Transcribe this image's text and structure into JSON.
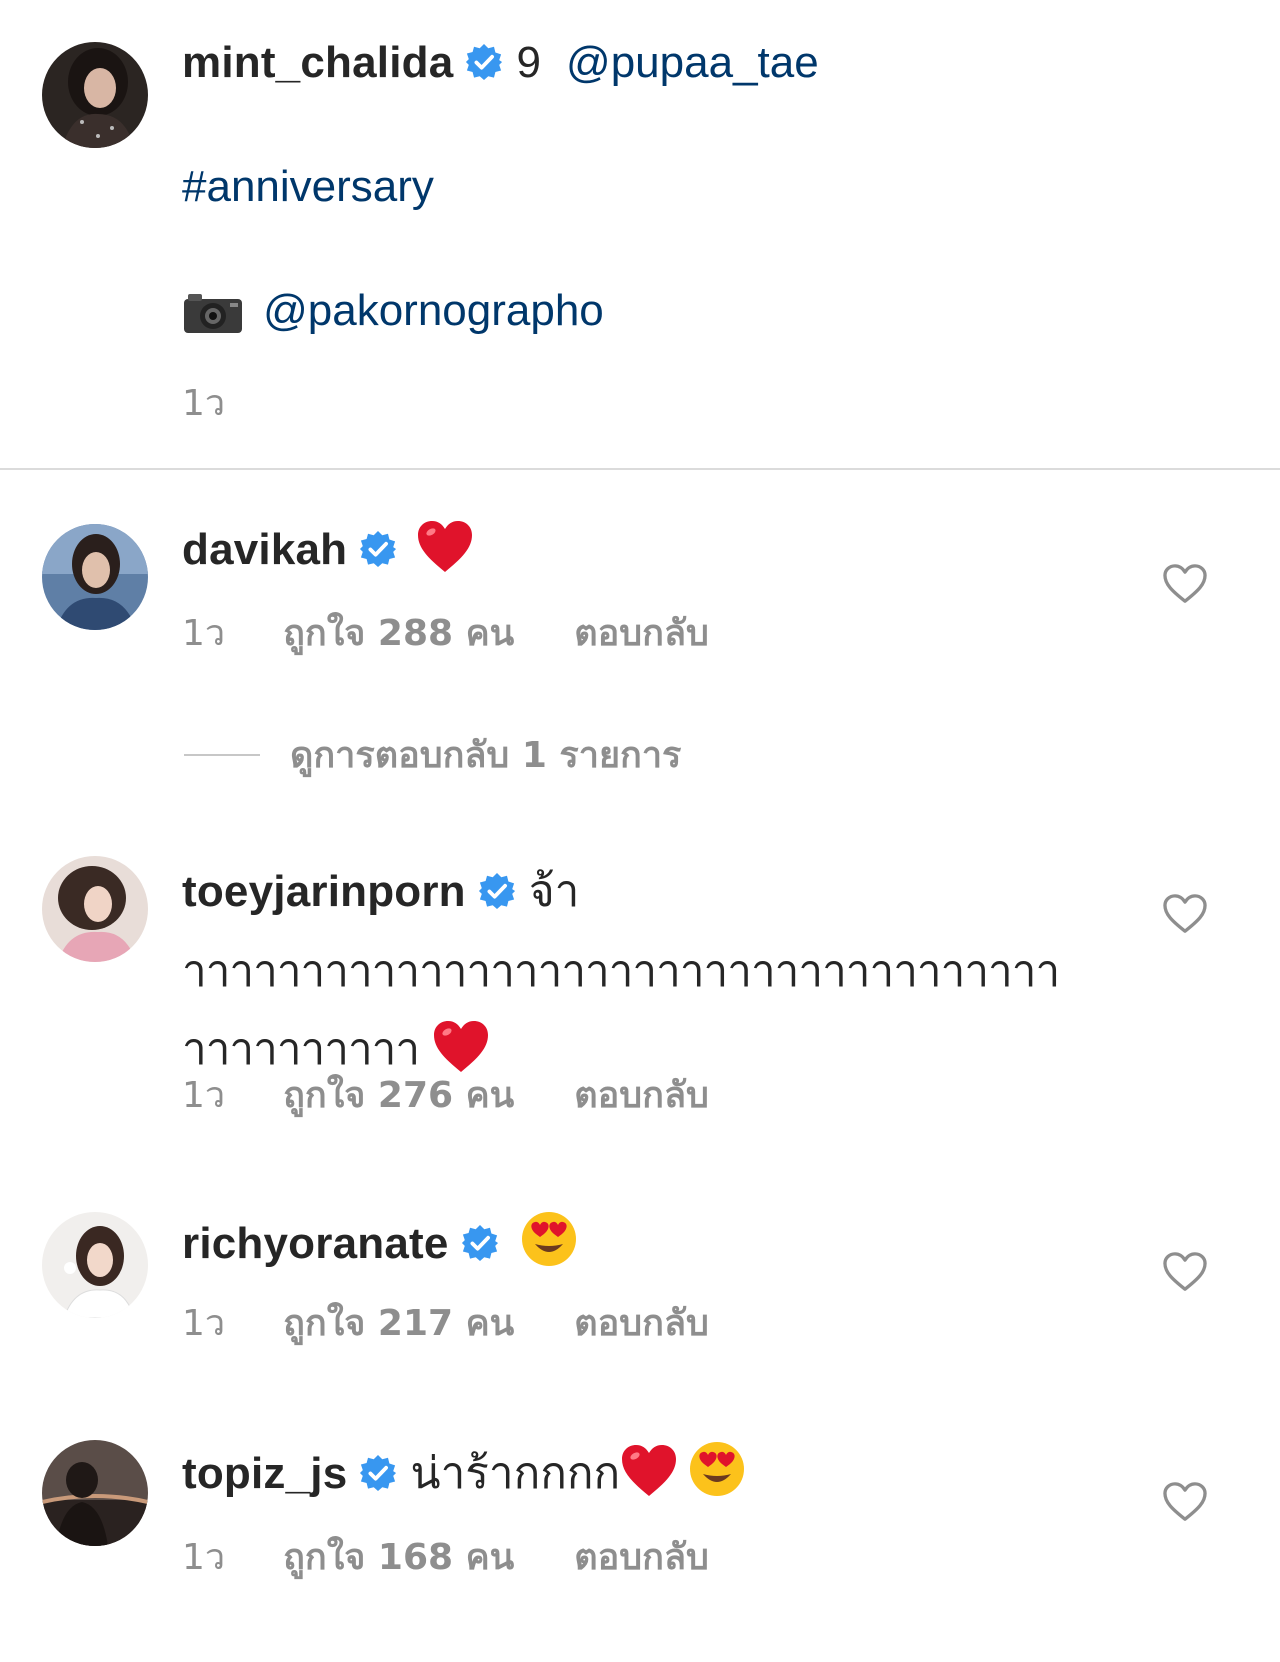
{
  "caption": {
    "username": "mint_chalida",
    "text_prefix": "9",
    "mention": "@pupaa_tae",
    "hashtag": "#anniversary",
    "camera_emoji": "📷",
    "photographer": "@pakornographo",
    "time": "1ว"
  },
  "view_replies_label": "ดูการตอบกลับ 1 รายการ",
  "comments": [
    {
      "username": "davikah",
      "text": "",
      "emojis": [
        "red-heart"
      ],
      "time": "1ว",
      "likes": "ถูกใจ 288 คน",
      "reply": "ตอบกลับ"
    },
    {
      "username": "toeyjarinporn",
      "text": "จ้า",
      "text_line2": "าาาาาาาาาาาาาาาาาาาาาาาาาาาาาาาาาาาาา",
      "text_line3": "าาาาาาาาาา",
      "emojis": [
        "red-heart"
      ],
      "time": "1ว",
      "likes": "ถูกใจ 276 คน",
      "reply": "ตอบกลับ"
    },
    {
      "username": "richyoranate",
      "text": "",
      "emojis": [
        "heart-eyes"
      ],
      "time": "1ว",
      "likes": "ถูกใจ 217 คน",
      "reply": "ตอบกลับ"
    },
    {
      "username": "topiz_js",
      "text": "น่าร้ากกกก",
      "emojis": [
        "red-heart",
        "heart-eyes"
      ],
      "time": "1ว",
      "likes": "ถูกใจ 168 คน",
      "reply": "ตอบกลับ"
    }
  ],
  "colors": {
    "verified": "#3897f0",
    "link": "#00376b",
    "meta": "#8e8e8e",
    "heart_emoji": "#e0132b"
  }
}
